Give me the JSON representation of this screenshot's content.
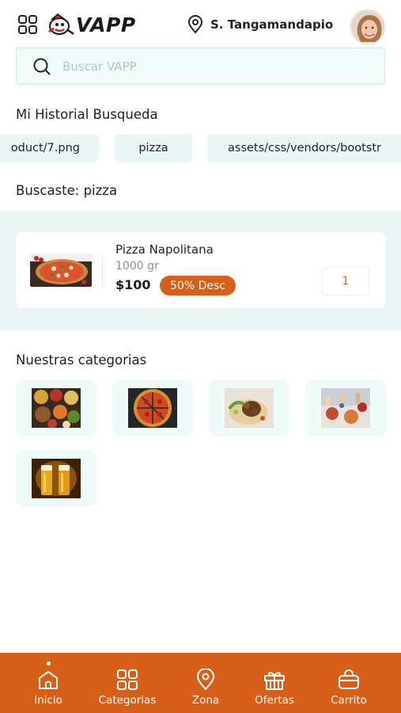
{
  "header": {
    "logo_text": "VAPP",
    "location": "S. Tangamandapio",
    "menu_icon": "grid-icon",
    "location_icon": "location-pin-icon"
  },
  "search": {
    "placeholder": "Buscar VAPP",
    "icon": "search-icon"
  },
  "history": {
    "title": "Mi Historial Busqueda",
    "items": [
      "oduct/7.png",
      "pizza",
      "assets/css/vendors/bootstr"
    ]
  },
  "results": {
    "title": "Buscaste: pizza",
    "items": [
      {
        "name": "Pizza Napolitana",
        "weight": "1000 gr",
        "price": "$100",
        "discount": "50% Desc",
        "quantity": "1"
      }
    ]
  },
  "categories": {
    "title": "Nuestras categorias",
    "items": [
      {
        "icon": "mexican-food-image"
      },
      {
        "icon": "pizza-image"
      },
      {
        "icon": "tacos-image"
      },
      {
        "icon": "dining-table-image"
      },
      {
        "icon": "beer-image"
      }
    ]
  },
  "bottom_nav": {
    "active": "Inicio",
    "items": [
      {
        "label": "Inicio",
        "icon": "home-icon"
      },
      {
        "label": "Categorias",
        "icon": "categories-icon"
      },
      {
        "label": "Zona",
        "icon": "location-pin-icon"
      },
      {
        "label": "Ofertas",
        "icon": "gift-icon"
      },
      {
        "label": "Carrito",
        "icon": "bag-icon"
      }
    ]
  },
  "colors": {
    "accent": "#d6601a",
    "mint_background": "#eaf6f5",
    "category_tile": "#eefbf8"
  }
}
